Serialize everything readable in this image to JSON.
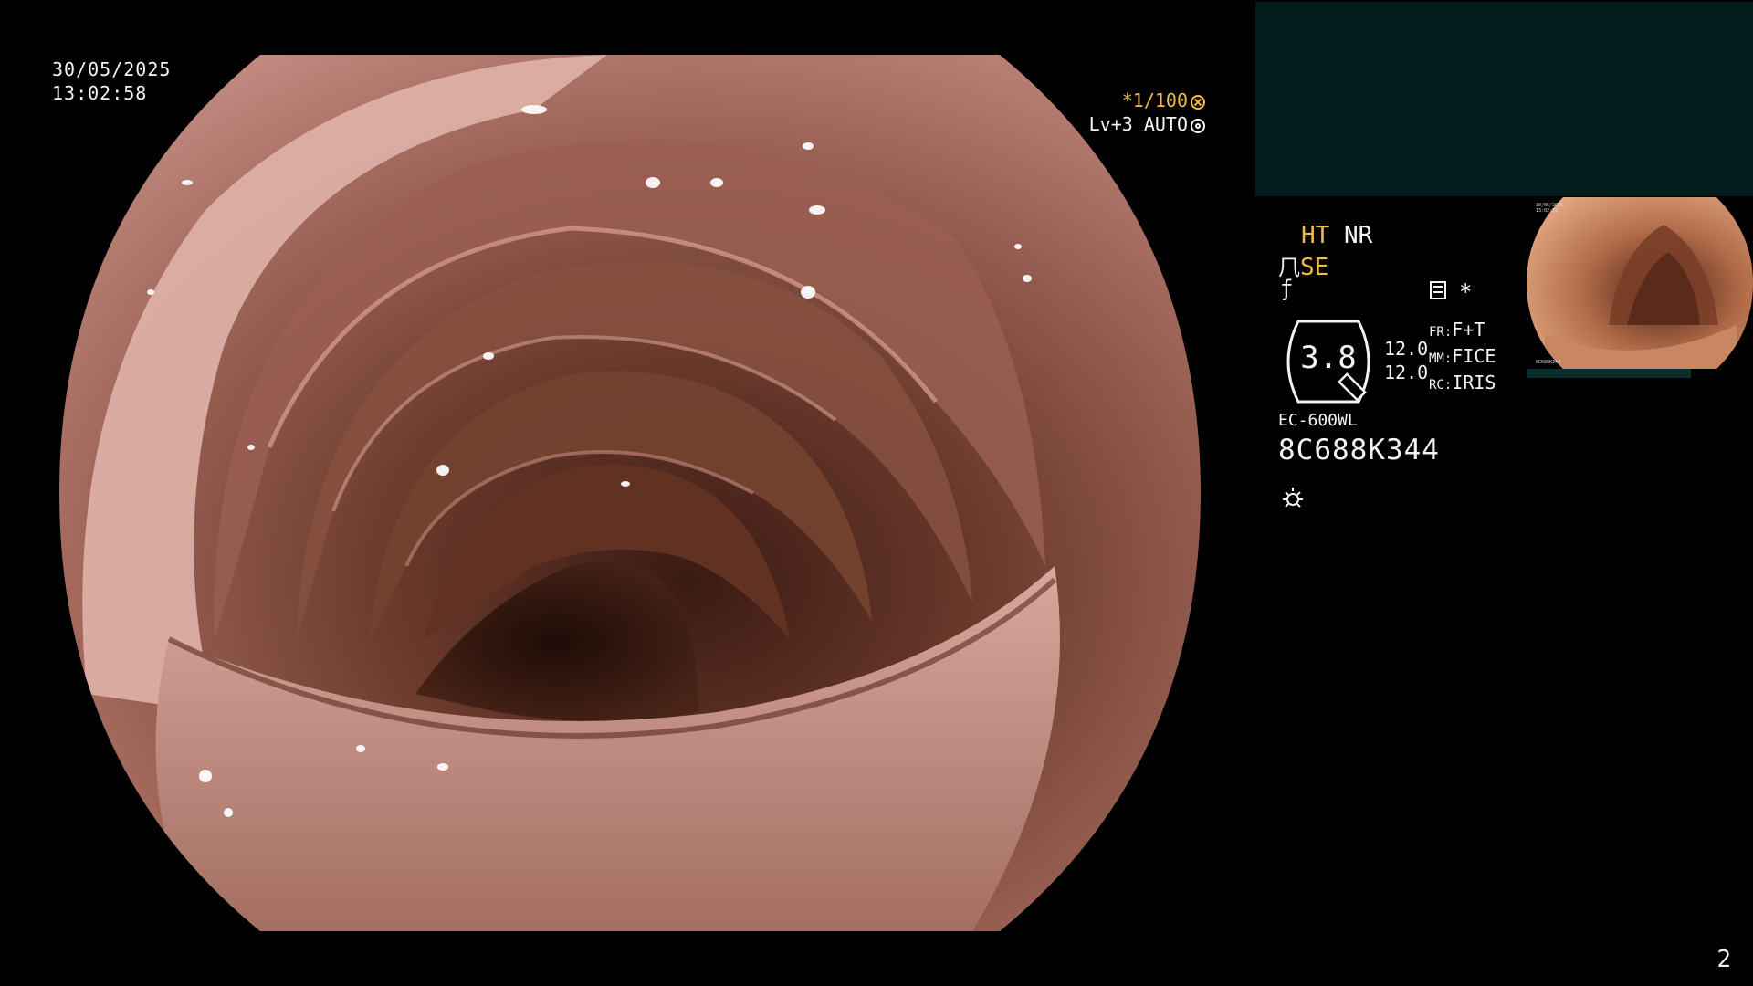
{
  "datetime": {
    "date": "30/05/2025",
    "time": "13:02:58"
  },
  "shutter": {
    "value": "*1/100",
    "icon": "shutter-speed-icon"
  },
  "light": {
    "level": "Lv+3",
    "mode": "AUTO",
    "icon": "iris-icon"
  },
  "enhancement": {
    "ht": "HT",
    "nr": "NR",
    "se": "SE",
    "se_icon": "structure-enhancement-icon",
    "f_icon": "color-filter-icon",
    "grid_icon": "image-mode-icon",
    "asterisk": "*"
  },
  "magnification": {
    "zoom": "3.8",
    "val1": "12.0",
    "val2": "12.0",
    "fr_label": "FR:",
    "fr_value": "F+T",
    "mm_label": "MM:",
    "mm_value": "FICE",
    "rc_label": "RC:",
    "rc_value": "IRIS"
  },
  "scope": {
    "model": "EC-600WL",
    "serial": "8C688K344",
    "lamp_icon": "lamp-icon"
  },
  "thumbnail": {
    "date": "30/05/2025",
    "time": "13:02:58",
    "serial": "8C688K344"
  },
  "page_number": "2",
  "colors": {
    "accent": "#f4b942",
    "pip_background": "#021b1b",
    "text": "#f2f2f2",
    "tissue": "#b07a70"
  }
}
